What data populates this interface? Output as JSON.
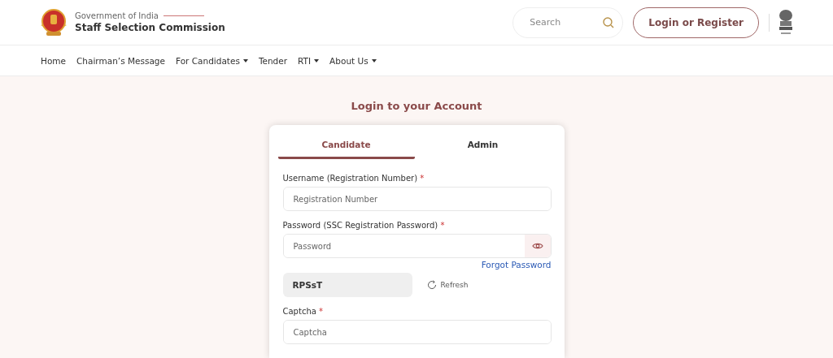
{
  "header": {
    "org_top": "Government of India",
    "org_name": "Staff Selection Commission",
    "search": {
      "placeholder": "Search"
    },
    "login_button": "Login or Register"
  },
  "nav": [
    {
      "label": "Home",
      "dropdown": false
    },
    {
      "label": "Chairman’s Message",
      "dropdown": false
    },
    {
      "label": "For Candidates",
      "dropdown": true
    },
    {
      "label": "Tender",
      "dropdown": false
    },
    {
      "label": "RTI",
      "dropdown": true
    },
    {
      "label": "About Us",
      "dropdown": true
    }
  ],
  "page_title": "Login to your Account",
  "tabs": [
    {
      "label": "Candidate",
      "selected": true
    },
    {
      "label": "Admin",
      "selected": false
    }
  ],
  "form": [
    {
      "kind": "input",
      "label": "Username (Registration Number)",
      "mark": "*",
      "placeholder": "Registration Number"
    },
    {
      "kind": "password",
      "label": "Password (SSC Registration Password)",
      "mark": "*",
      "placeholder": "Password",
      "link": "Forgot Password"
    },
    {
      "kind": "captcha",
      "code": "RPSsT",
      "refresh": "Refresh"
    },
    {
      "kind": "input",
      "label": "Captcha",
      "mark": "*",
      "placeholder": "Captcha"
    }
  ]
}
